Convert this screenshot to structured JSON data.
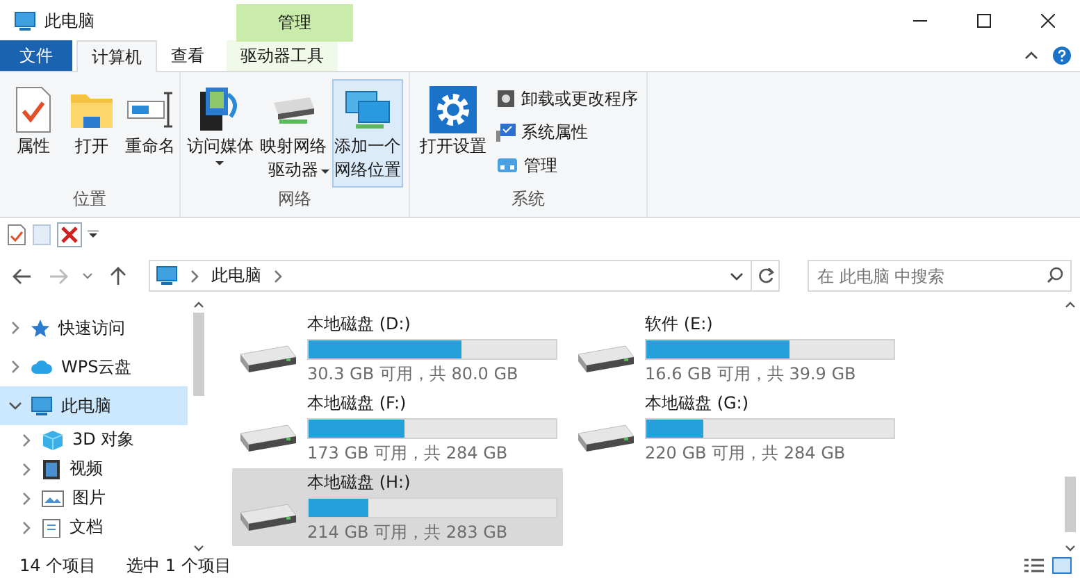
{
  "window": {
    "title": "此电脑"
  },
  "tabs": [
    {
      "label": "文件",
      "kind": "file",
      "selected": false
    },
    {
      "label": "计算机",
      "kind": "normal",
      "selected": true
    },
    {
      "label": "查看",
      "kind": "normal",
      "selected": false
    },
    {
      "label": "驱动器工具",
      "kind": "context",
      "context_label": "管理",
      "selected": false
    }
  ],
  "ribbon": {
    "groups": [
      {
        "label": "位置",
        "buttons": [
          {
            "kind": "large",
            "label": "属性",
            "highlighted": false
          },
          {
            "kind": "large",
            "label": "打开",
            "highlighted": false
          },
          {
            "kind": "large",
            "label": "重命名",
            "highlighted": false
          }
        ]
      },
      {
        "label": "网络",
        "buttons": [
          {
            "kind": "large",
            "label": "访问媒体",
            "has_menu": true,
            "highlighted": false
          },
          {
            "kind": "large",
            "label": "映射网络驱动器",
            "has_menu": true,
            "highlighted": false
          },
          {
            "kind": "large",
            "label": "添加一个网络位置",
            "highlighted": true
          }
        ]
      },
      {
        "label": "系统",
        "buttons": [
          {
            "kind": "large",
            "label": "打开设置",
            "highlighted": false
          },
          {
            "kind": "small",
            "label": "卸载或更改程序"
          },
          {
            "kind": "small",
            "label": "系统属性"
          },
          {
            "kind": "small",
            "label": "管理"
          }
        ]
      }
    ]
  },
  "address_bar": {
    "path": [
      "此电脑"
    ],
    "search_placeholder": "在 此电脑 中搜索"
  },
  "sidebar": {
    "items": [
      {
        "label": "快速访问",
        "expanded": false,
        "selected": false
      },
      {
        "label": "WPS云盘",
        "expanded": false,
        "selected": false
      },
      {
        "label": "此电脑",
        "expanded": true,
        "selected": true,
        "children": [
          {
            "label": "3D 对象",
            "expanded": false,
            "selected": false
          },
          {
            "label": "视频",
            "expanded": false,
            "selected": false
          },
          {
            "label": "图片",
            "expanded": false,
            "selected": false
          },
          {
            "label": "文档",
            "expanded": false,
            "selected": false
          }
        ]
      }
    ]
  },
  "drives": [
    {
      "name": "本地磁盘 (D:)",
      "level": 0.62,
      "info": "30.3 GB 可用，共 80.0 GB",
      "selected": false
    },
    {
      "name": "软件 (E:)",
      "level": 0.58,
      "info": "16.6 GB 可用，共 39.9 GB",
      "selected": false
    },
    {
      "name": "本地磁盘 (F:)",
      "level": 0.39,
      "info": "173 GB 可用，共 284 GB",
      "selected": false
    },
    {
      "name": "本地磁盘 (G:)",
      "level": 0.23,
      "info": "220 GB 可用，共 284 GB",
      "selected": false
    },
    {
      "name": "本地磁盘 (H:)",
      "level": 0.24,
      "info": "214 GB 可用，共 283 GB",
      "selected": true
    }
  ],
  "status_bar": {
    "item_count": "14 个项目",
    "selection": "选中 1 个项目"
  }
}
